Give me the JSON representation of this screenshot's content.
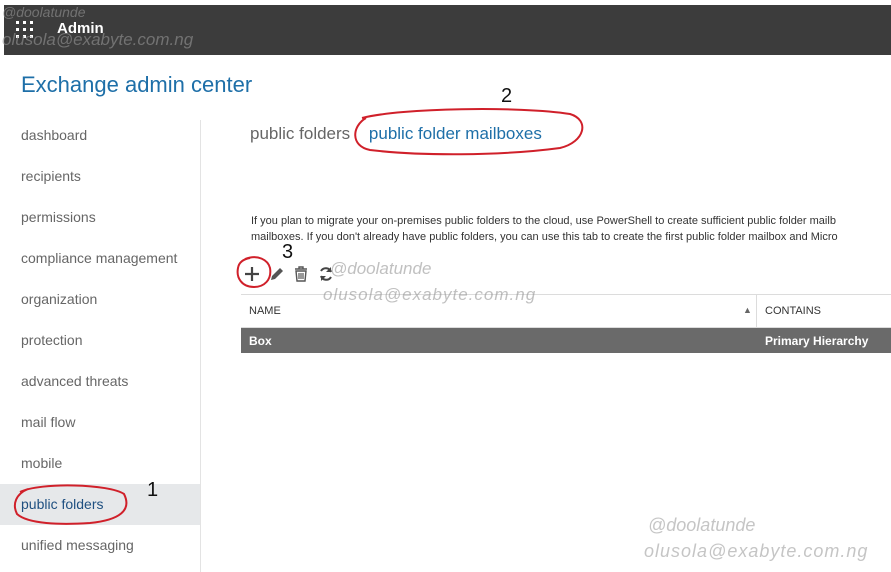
{
  "topbar": {
    "app_name": "Admin",
    "launcher_icon": "waffle-grid-icon",
    "background": "#3c3c3c"
  },
  "header": {
    "title": "Exchange admin center"
  },
  "sidebar": {
    "items": [
      {
        "label": "dashboard"
      },
      {
        "label": "recipients"
      },
      {
        "label": "permissions"
      },
      {
        "label": "compliance management"
      },
      {
        "label": "organization"
      },
      {
        "label": "protection"
      },
      {
        "label": "advanced threats"
      },
      {
        "label": "mail flow"
      },
      {
        "label": "mobile"
      },
      {
        "label": "public folders",
        "active": true
      },
      {
        "label": "unified messaging"
      }
    ]
  },
  "tabs": [
    {
      "label": "public folders"
    },
    {
      "label": "public folder mailboxes",
      "active": true
    }
  ],
  "info": {
    "line1": "If you plan to migrate your on-premises public folders to the cloud, use PowerShell to create sufficient public folder mailb",
    "line2": "mailboxes. If you don't already have public folders, you can use this tab to create the first public folder mailbox and Micro"
  },
  "toolbar": {
    "icons": [
      "add-icon",
      "edit-icon",
      "delete-icon",
      "refresh-icon"
    ]
  },
  "table": {
    "columns": [
      "NAME",
      "CONTAINS"
    ],
    "sort_indicator": "▲",
    "rows": [
      {
        "name": "Box",
        "contains": "Primary Hierarchy",
        "selected": true
      }
    ]
  },
  "annotations": {
    "step1": "1",
    "step2": "2",
    "step3": "3",
    "ink_color": "#d0202a"
  },
  "watermarks": {
    "handle": "@doolatunde",
    "email": "olusola@exabyte.com.ng"
  },
  "colors": {
    "accent": "#1e6fa8",
    "selected_row": "#6a6a6a"
  }
}
